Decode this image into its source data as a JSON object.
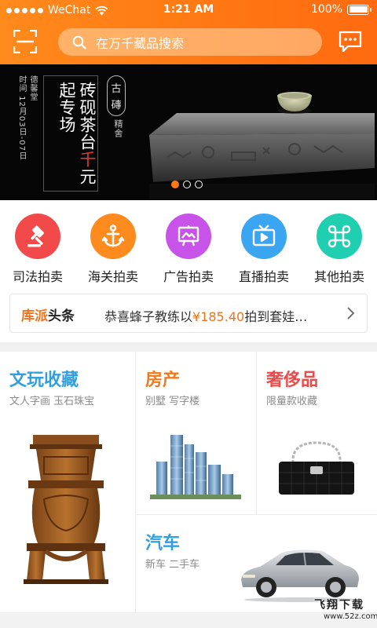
{
  "status_bar": {
    "carrier": "WeChat",
    "time": "1:21 AM",
    "battery": "100%"
  },
  "header": {
    "search_placeholder": "在万千藏品搜索"
  },
  "banner": {
    "meta_line1": "德馨堂",
    "meta_line2": "时间 12月03日-07日",
    "title_line1": "起专场",
    "title_line2_prefix": "砖砚茶台",
    "title_line2_highlight": "千",
    "title_line2_suffix": "元",
    "seal_chars": [
      "古",
      "磚"
    ],
    "seal_sub": "精舍",
    "page_count": 3,
    "active_page": 0
  },
  "categories": [
    {
      "label": "司法拍卖",
      "icon": "gavel-icon",
      "color": "#f24a4a"
    },
    {
      "label": "海关拍卖",
      "icon": "anchor-icon",
      "color": "#ff8a1e"
    },
    {
      "label": "广告拍卖",
      "icon": "billboard-icon",
      "color": "#c753e8"
    },
    {
      "label": "直播拍卖",
      "icon": "tv-icon",
      "color": "#3aa6f2"
    },
    {
      "label": "其他拍卖",
      "icon": "command-icon",
      "color": "#1fcfb0"
    }
  ],
  "news": {
    "brand_part1": "库派",
    "brand_part2": "头条",
    "text_prefix": "恭喜蜂子教练以",
    "price": "¥185.40",
    "text_suffix": "拍到套娃…"
  },
  "tiles": {
    "wenwan": {
      "title": "文玩收藏",
      "subtitle": "文人字画 玉石珠宝"
    },
    "fangchan": {
      "title": "房产",
      "subtitle": "别墅 写字楼"
    },
    "shechi": {
      "title": "奢侈品",
      "subtitle": "限量款收藏"
    },
    "qiche": {
      "title": "汽车",
      "subtitle": "新车 二手车"
    }
  },
  "watermark": {
    "line1": "飞翔下载",
    "line2": "www.52z.com"
  }
}
